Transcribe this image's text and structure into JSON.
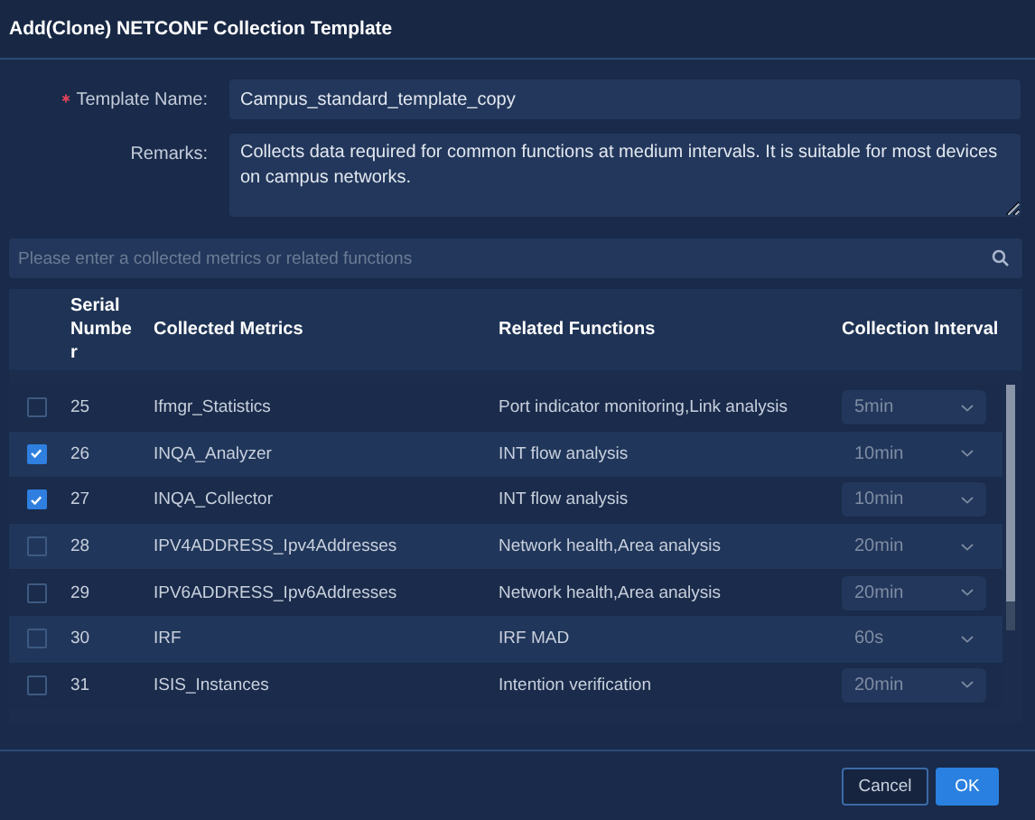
{
  "dialog": {
    "title": "Add(Clone) NETCONF Collection Template"
  },
  "form": {
    "template_name": {
      "label": "Template Name:",
      "required": true,
      "value": "Campus_standard_template_copy"
    },
    "remarks": {
      "label": "Remarks:",
      "value": "Collects data required for common functions at medium intervals. It is suitable for most devices on campus networks."
    }
  },
  "search": {
    "placeholder": "Please enter a collected metrics or related functions"
  },
  "table": {
    "columns": [
      "Serial Number",
      "Collected Metrics",
      "Related Functions",
      "Collection Interval"
    ],
    "rows": [
      {
        "checked": false,
        "serial": "25",
        "metric": "Ifmgr_Statistics",
        "functions": "Port indicator monitoring,Link analysis",
        "interval": "5min"
      },
      {
        "checked": true,
        "serial": "26",
        "metric": "INQA_Analyzer",
        "functions": "INT flow analysis",
        "interval": "10min"
      },
      {
        "checked": true,
        "serial": "27",
        "metric": "INQA_Collector",
        "functions": "INT flow analysis",
        "interval": "10min"
      },
      {
        "checked": false,
        "serial": "28",
        "metric": "IPV4ADDRESS_Ipv4Addresses",
        "functions": "Network health,Area analysis",
        "interval": "20min"
      },
      {
        "checked": false,
        "serial": "29",
        "metric": "IPV6ADDRESS_Ipv6Addresses",
        "functions": "Network health,Area analysis",
        "interval": "20min"
      },
      {
        "checked": false,
        "serial": "30",
        "metric": "IRF",
        "functions": "IRF MAD",
        "interval": "60s"
      },
      {
        "checked": false,
        "serial": "31",
        "metric": "ISIS_Instances",
        "functions": "Intention verification",
        "interval": "20min"
      }
    ]
  },
  "buttons": [
    {
      "label": "Cancel",
      "kind": "secondary"
    },
    {
      "label": "OK",
      "kind": "primary"
    }
  ]
}
